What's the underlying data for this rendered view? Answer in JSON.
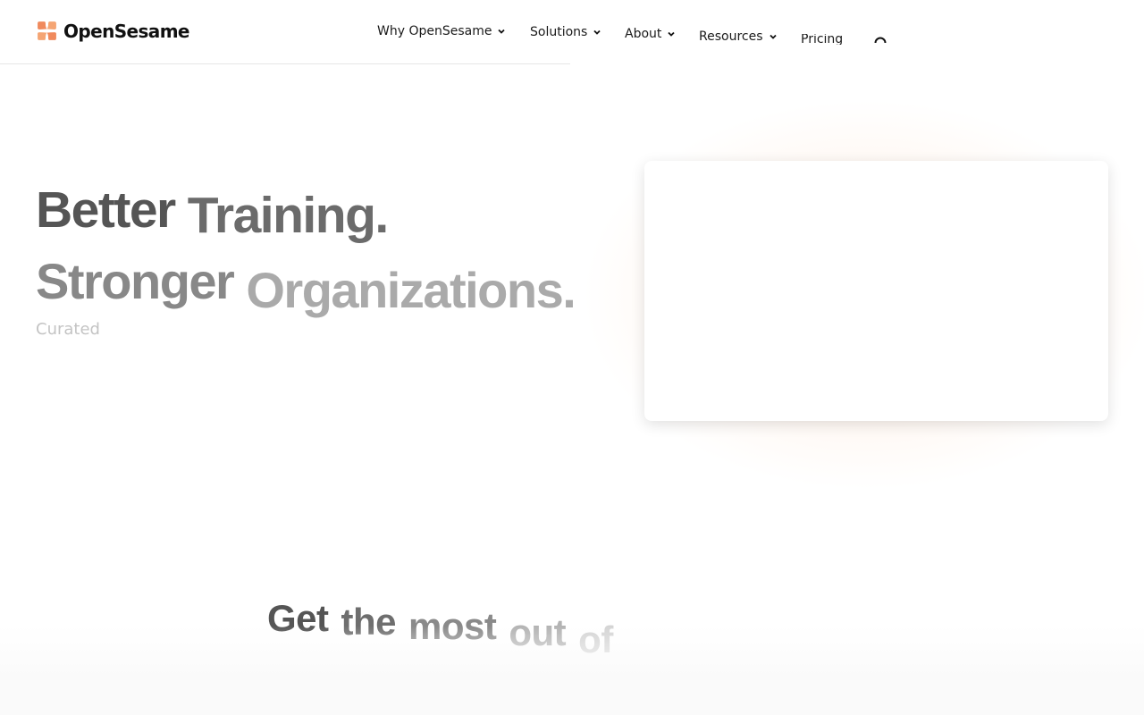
{
  "brand": {
    "name": "OpenSesame",
    "accent": "#f08a5d"
  },
  "nav": {
    "items": [
      {
        "label": "Why OpenSesame",
        "has_dropdown": true
      },
      {
        "label": "Solutions",
        "has_dropdown": true
      },
      {
        "label": "About",
        "has_dropdown": true
      },
      {
        "label": "Resources",
        "has_dropdown": true
      },
      {
        "label": "Pricing",
        "has_dropdown": false
      }
    ],
    "search_icon": "search-icon"
  },
  "hero": {
    "line1": [
      "Better",
      "Training."
    ],
    "line2": [
      "Stronger",
      "Organizations."
    ],
    "subtext": "Curated"
  },
  "section": {
    "heading_words": [
      "Get",
      "the",
      "most",
      "out",
      "of"
    ]
  },
  "colors": {
    "text_dark": "#555555",
    "text_mid": "#777777",
    "text_light": "#a9a9a9",
    "text_faint": "#c4c4c4"
  }
}
